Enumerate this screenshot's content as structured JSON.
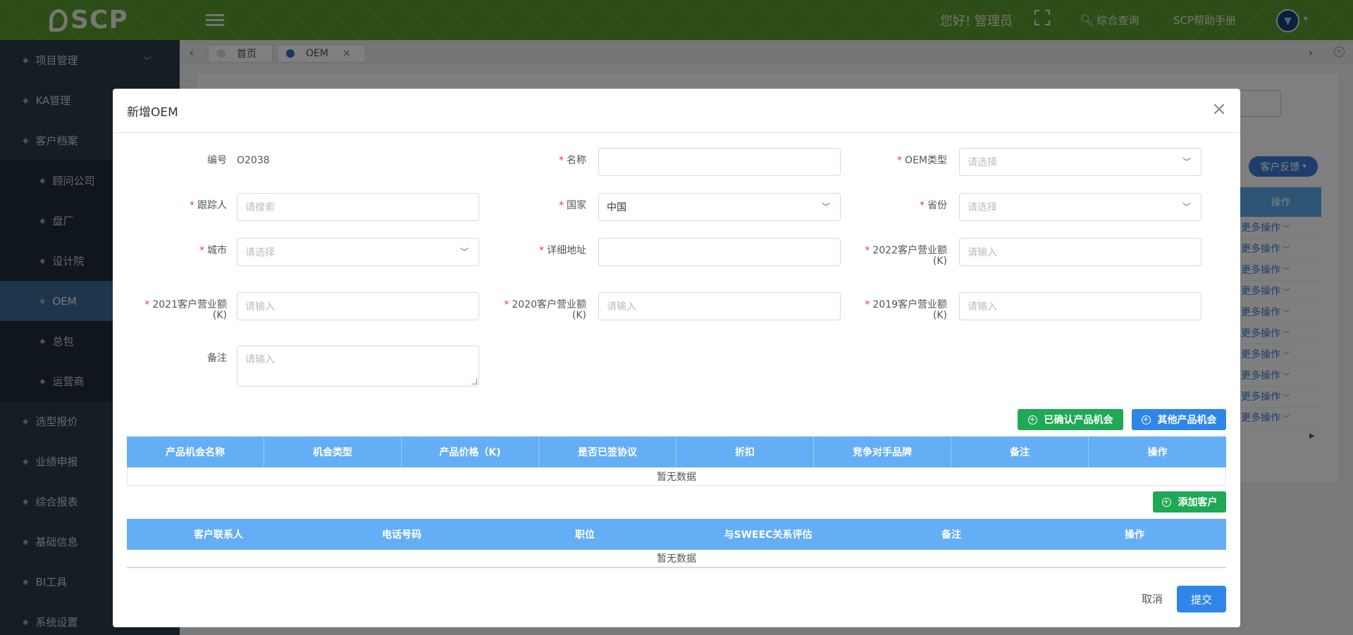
{
  "app": {
    "logo_text": "SCP"
  },
  "topbar": {
    "greeting": "您好! 管理员",
    "search_label": "综合查询",
    "help_label": "SCP帮助手册"
  },
  "sidebar": {
    "items": [
      {
        "label": "项目管理",
        "level": 1,
        "expandable": true
      },
      {
        "label": "KA管理",
        "level": 1
      },
      {
        "label": "客户档案",
        "level": 1
      },
      {
        "label": "顾问公司",
        "level": 2
      },
      {
        "label": "盘厂",
        "level": 2
      },
      {
        "label": "设计院",
        "level": 2
      },
      {
        "label": "OEM",
        "level": 2,
        "active": true
      },
      {
        "label": "总包",
        "level": 2
      },
      {
        "label": "运营商",
        "level": 2
      },
      {
        "label": "选型报价",
        "level": 1
      },
      {
        "label": "业绩申报",
        "level": 1
      },
      {
        "label": "综合报表",
        "level": 1
      },
      {
        "label": "基础信息",
        "level": 1
      },
      {
        "label": "BI工具",
        "level": 1
      },
      {
        "label": "系统设置",
        "level": 1
      }
    ]
  },
  "tabs": [
    {
      "label": "首页"
    },
    {
      "label": "OEM",
      "closable": true
    }
  ],
  "background": {
    "feedback_button": "客户反馈",
    "op_header": "操作",
    "more_ops": [
      "更多操作",
      "更多操作",
      "更多操作",
      "更多操作",
      "更多操作",
      "更多操作",
      "更多操作",
      "更多操作",
      "更多操作",
      "更多操作"
    ]
  },
  "modal": {
    "title": "新增OEM",
    "fields": {
      "code": {
        "label": "编号",
        "value": "O2038"
      },
      "name": {
        "label": "名称",
        "value": ""
      },
      "oem_type": {
        "label": "OEM类型",
        "placeholder": "请选择"
      },
      "tracker": {
        "label": "跟踪人",
        "placeholder": "请搜索"
      },
      "country": {
        "label": "国家",
        "value": "中国"
      },
      "province": {
        "label": "省份",
        "placeholder": "请选择"
      },
      "city": {
        "label": "城市",
        "placeholder": "请选择"
      },
      "address": {
        "label": "详细地址",
        "value": ""
      },
      "rev2022": {
        "label": "2022客户营业额",
        "unit": "(K)",
        "placeholder": "请输入"
      },
      "rev2021": {
        "label": "2021客户营业额",
        "unit": "(K)",
        "placeholder": "请输入"
      },
      "rev2020": {
        "label": "2020客户营业额",
        "unit": "(K)",
        "placeholder": "请输入"
      },
      "rev2019": {
        "label": "2019客户营业额",
        "unit": "(K)",
        "placeholder": "请输入"
      },
      "remark": {
        "label": "备注",
        "placeholder": "请输入"
      }
    },
    "buttons": {
      "confirmed_opportunity": "已确认产品机会",
      "other_opportunity": "其他产品机会",
      "add_customer": "添加客户",
      "cancel": "取消",
      "submit": "提交"
    },
    "opportunity_table": {
      "columns": [
        "产品机会名称",
        "机会类型",
        "产品价格（K)",
        "是否已签协议",
        "折扣",
        "竞争对手品牌",
        "备注",
        "操作"
      ],
      "empty_text": "暂无数据"
    },
    "contact_table": {
      "columns": [
        "客户联系人",
        "电话号码",
        "职位",
        "与SWEEC关系评估",
        "备注",
        "操作"
      ],
      "empty_text": "暂无数据"
    }
  }
}
